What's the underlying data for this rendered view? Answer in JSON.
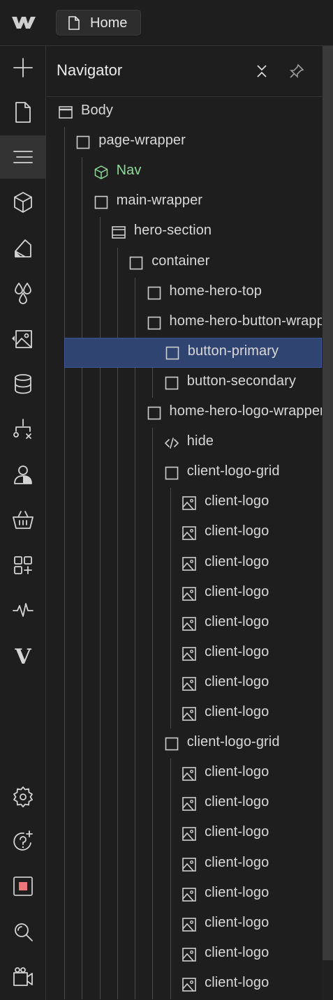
{
  "topbar": {
    "page_tab_label": "Home",
    "logo_icon": "webflow-logo-icon",
    "page_icon": "page-icon"
  },
  "rail": {
    "items": [
      {
        "name": "add-icon"
      },
      {
        "name": "pages-icon"
      },
      {
        "name": "navigator-icon",
        "active": true
      },
      {
        "name": "components-icon"
      },
      {
        "name": "style-selectors-icon"
      },
      {
        "name": "variables-icon"
      },
      {
        "name": "assets-icon"
      },
      {
        "name": "cms-icon"
      },
      {
        "name": "logic-icon"
      },
      {
        "name": "users-icon"
      },
      {
        "name": "ecommerce-icon"
      },
      {
        "name": "apps-icon"
      },
      {
        "name": "audits-icon"
      },
      {
        "name": "v-app-icon"
      },
      {
        "name": "settings-icon"
      },
      {
        "name": "help-icon"
      },
      {
        "name": "record-icon"
      },
      {
        "name": "search-icon"
      },
      {
        "name": "video-icon"
      }
    ]
  },
  "navigator": {
    "title": "Navigator",
    "close_icon": "collapse-icon",
    "pin_icon": "pin-icon",
    "colors": {
      "selected_bg": "#2f4470",
      "component": "#8fd99a"
    },
    "tree": [
      {
        "label": "Body",
        "icon": "body-icon",
        "depth": 0
      },
      {
        "label": "page-wrapper",
        "icon": "div-icon",
        "depth": 1
      },
      {
        "label": "Nav",
        "icon": "component-icon",
        "depth": 2,
        "component": true
      },
      {
        "label": "main-wrapper",
        "icon": "div-icon",
        "depth": 2
      },
      {
        "label": "hero-section",
        "icon": "section-icon",
        "depth": 3
      },
      {
        "label": "container",
        "icon": "div-icon",
        "depth": 4
      },
      {
        "label": "home-hero-top",
        "icon": "div-icon",
        "depth": 5
      },
      {
        "label": "home-hero-button-wrapper",
        "icon": "div-icon",
        "depth": 5
      },
      {
        "label": "button-primary",
        "icon": "div-icon",
        "depth": 6,
        "selected": true
      },
      {
        "label": "button-secondary",
        "icon": "div-icon",
        "depth": 6
      },
      {
        "label": "home-hero-logo-wrapper",
        "icon": "div-icon",
        "depth": 5
      },
      {
        "label": "hide",
        "icon": "code-icon",
        "depth": 6
      },
      {
        "label": "client-logo-grid",
        "icon": "div-icon",
        "depth": 6
      },
      {
        "label": "client-logo",
        "icon": "image-icon",
        "depth": 7
      },
      {
        "label": "client-logo",
        "icon": "image-icon",
        "depth": 7
      },
      {
        "label": "client-logo",
        "icon": "image-icon",
        "depth": 7
      },
      {
        "label": "client-logo",
        "icon": "image-icon",
        "depth": 7
      },
      {
        "label": "client-logo",
        "icon": "image-icon",
        "depth": 7
      },
      {
        "label": "client-logo",
        "icon": "image-icon",
        "depth": 7
      },
      {
        "label": "client-logo",
        "icon": "image-icon",
        "depth": 7
      },
      {
        "label": "client-logo",
        "icon": "image-icon",
        "depth": 7
      },
      {
        "label": "client-logo-grid",
        "icon": "div-icon",
        "depth": 6
      },
      {
        "label": "client-logo",
        "icon": "image-icon",
        "depth": 7
      },
      {
        "label": "client-logo",
        "icon": "image-icon",
        "depth": 7
      },
      {
        "label": "client-logo",
        "icon": "image-icon",
        "depth": 7
      },
      {
        "label": "client-logo",
        "icon": "image-icon",
        "depth": 7
      },
      {
        "label": "client-logo",
        "icon": "image-icon",
        "depth": 7
      },
      {
        "label": "client-logo",
        "icon": "image-icon",
        "depth": 7
      },
      {
        "label": "client-logo",
        "icon": "image-icon",
        "depth": 7
      },
      {
        "label": "client-logo",
        "icon": "image-icon",
        "depth": 7
      }
    ]
  }
}
